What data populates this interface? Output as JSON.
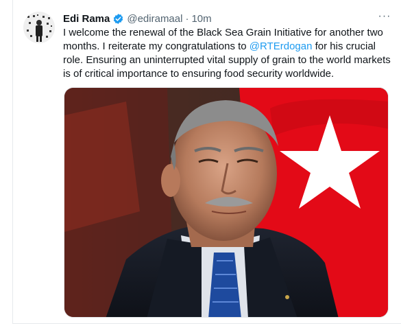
{
  "tweet": {
    "author_name": "Edi Rama",
    "handle": "@ediramaal",
    "separator": "·",
    "time": "10m",
    "more_label": "···",
    "text_part1": "I welcome the renewal of the Black Sea Grain Initiative for another two months. I reiterate my congratulations to ",
    "mention": "@RTErdogan",
    "text_part2": " for his crucial role. Ensuring an uninterrupted vital supply of grain to the world markets is of critical importance to ensuring food security worldwide."
  },
  "colors": {
    "verified_badge": "#1d9bf0",
    "mention": "#1d9bf0",
    "secondary_text": "#536471",
    "flag_red": "#e30a17"
  },
  "icons": {
    "verified": "verified-badge-icon",
    "more": "more-options-icon"
  }
}
